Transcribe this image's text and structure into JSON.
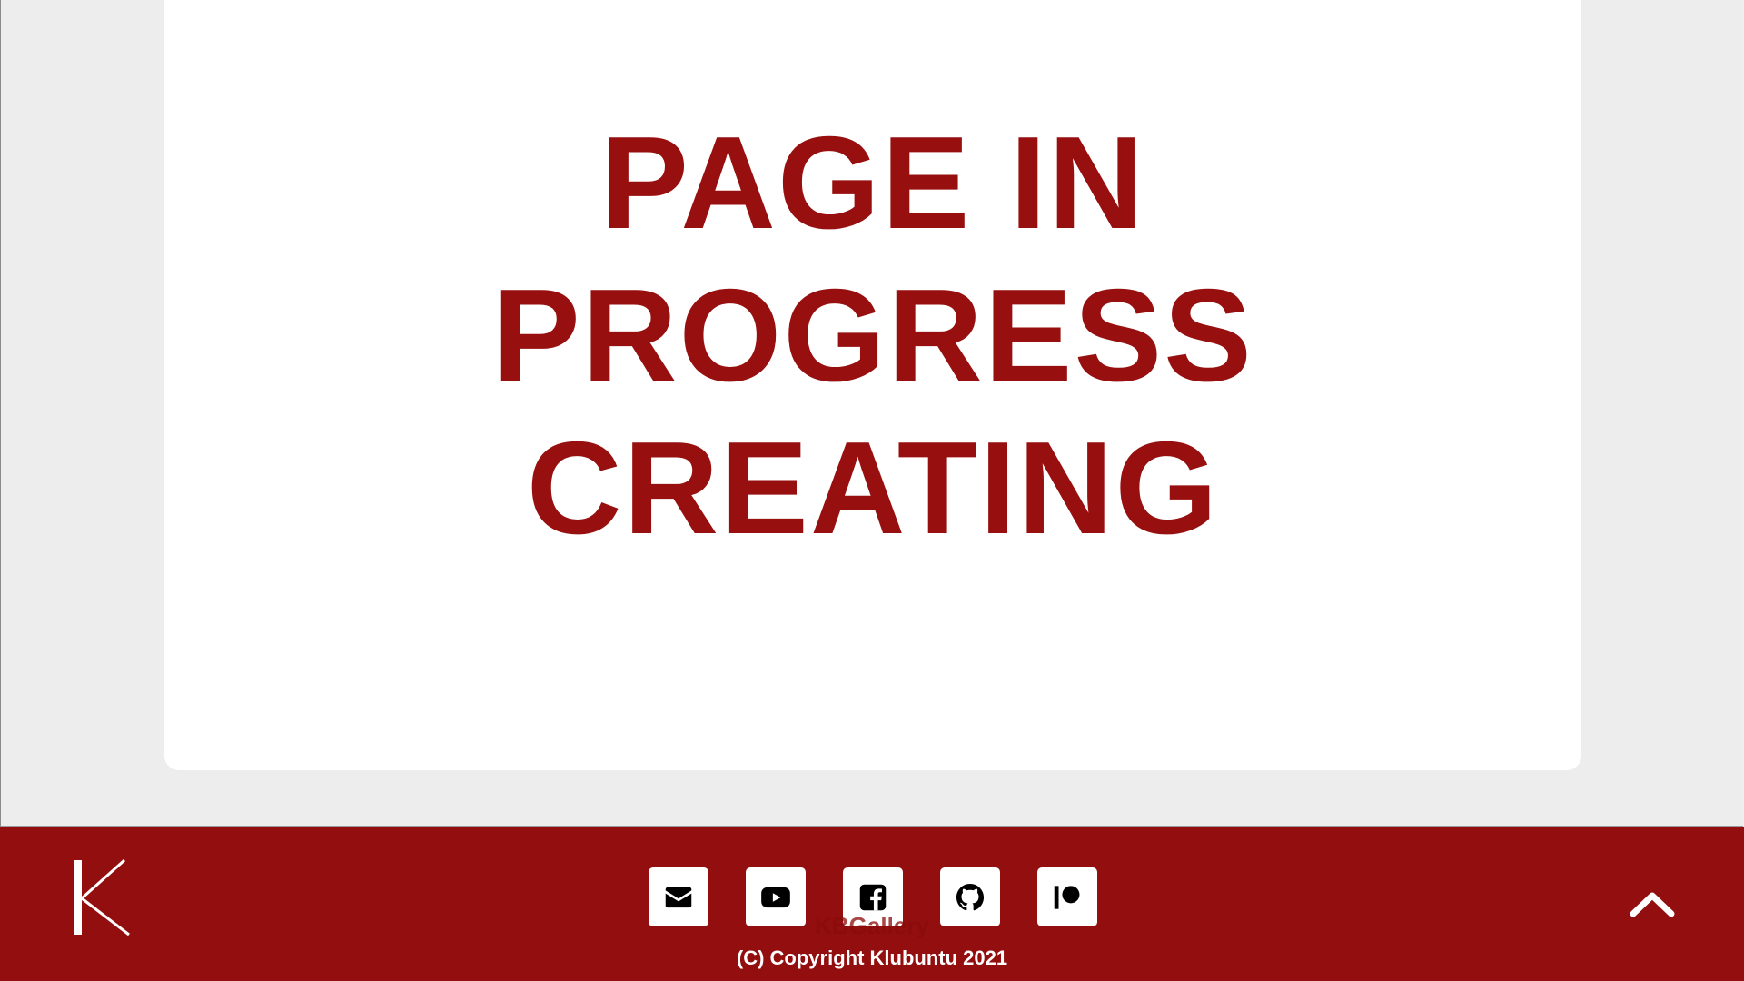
{
  "main": {
    "headline_lines": [
      "PAGE IN",
      "PROGRESS",
      "CREATING"
    ]
  },
  "footer": {
    "logo_letter": "K",
    "brand": "KBGallery",
    "copyright": "(C) Copyright Klubuntu 2021",
    "social": [
      {
        "name": "email",
        "icon": "envelope-icon"
      },
      {
        "name": "youtube",
        "icon": "youtube-icon"
      },
      {
        "name": "facebook",
        "icon": "facebook-icon"
      },
      {
        "name": "github",
        "icon": "github-icon"
      },
      {
        "name": "patreon",
        "icon": "patreon-icon"
      }
    ],
    "scroll_top_icon": "chevron-up-icon"
  },
  "colors": {
    "accent": "#930e0e",
    "headline": "#970f0f",
    "background": "#ededed",
    "card": "#ffffff"
  }
}
